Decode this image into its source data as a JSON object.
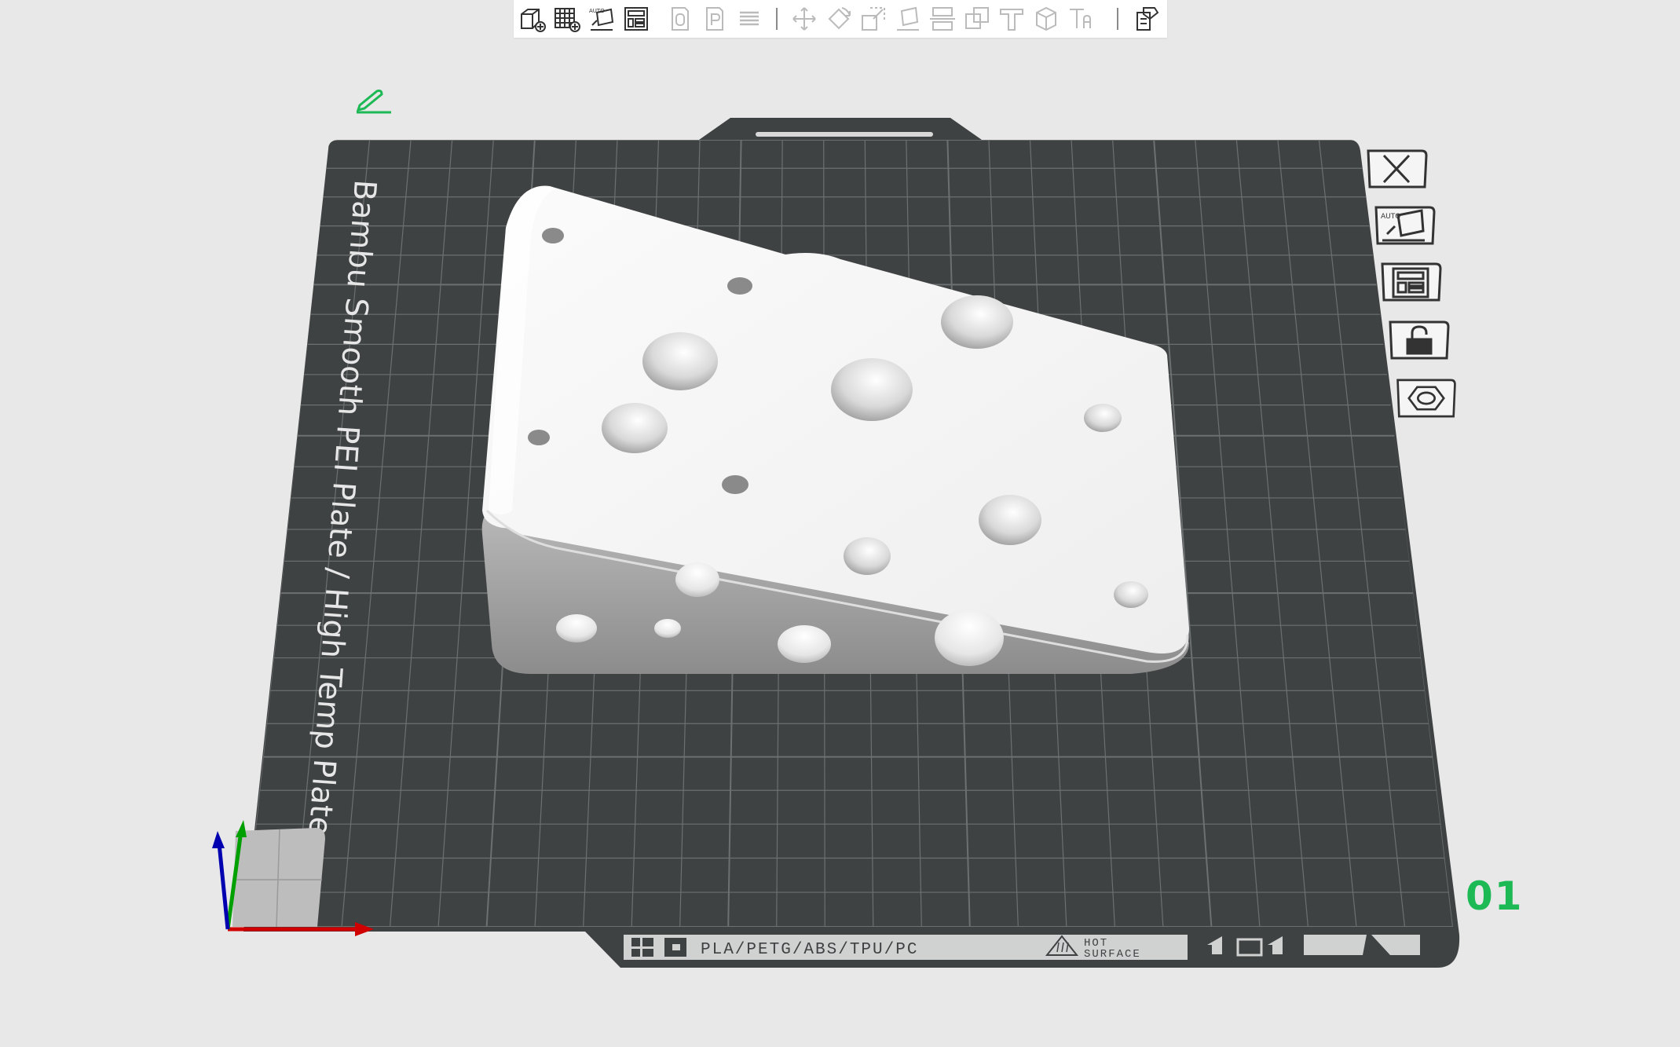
{
  "plate": {
    "title": "Bambu Smooth PEI Plate / High Temp Plate",
    "filaments": "PLA/PETG/ABS/TPU/PC",
    "warning_line1": "HOT",
    "warning_line2": "SURFACE",
    "number": "01"
  },
  "toolbar": {
    "auto_badge": "AUTO",
    "items": [
      {
        "icon": "add-object-icon",
        "enabled": true
      },
      {
        "icon": "add-plate-icon",
        "enabled": true
      },
      {
        "icon": "auto-orient-icon",
        "enabled": true
      },
      {
        "icon": "arrange-icon",
        "enabled": true
      },
      {
        "icon": "split-objects-icon",
        "enabled": false
      },
      {
        "icon": "split-parts-icon",
        "enabled": false
      },
      {
        "icon": "variable-layer-icon",
        "enabled": false
      },
      {
        "icon": "move-icon",
        "enabled": false
      },
      {
        "icon": "rotate-icon",
        "enabled": false
      },
      {
        "icon": "scale-icon",
        "enabled": false
      },
      {
        "icon": "lay-on-face-icon",
        "enabled": false
      },
      {
        "icon": "cut-icon",
        "enabled": false
      },
      {
        "icon": "boolean-icon",
        "enabled": false
      },
      {
        "icon": "support-paint-icon",
        "enabled": false
      },
      {
        "icon": "seam-paint-icon",
        "enabled": false
      },
      {
        "icon": "text-icon",
        "enabled": false
      },
      {
        "icon": "assembly-view-icon",
        "enabled": true
      }
    ]
  },
  "plate_tools": {
    "auto_badge": "AUTO",
    "items": [
      {
        "icon": "close-icon",
        "label": "Delete plate"
      },
      {
        "icon": "auto-orient-icon",
        "label": "Auto orient"
      },
      {
        "icon": "arrange-icon",
        "label": "Arrange"
      },
      {
        "icon": "lock-icon",
        "label": "Lock plate"
      },
      {
        "icon": "plate-settings-icon",
        "label": "Plate settings"
      }
    ]
  },
  "colors": {
    "background": "#e8e8e8",
    "plate": "#3f4243",
    "grid": "#6c7071",
    "accent": "#1db954",
    "model": "#f4f4f4",
    "axis_x": "#d00000",
    "axis_y": "#00a000",
    "axis_z": "#0000b0"
  }
}
